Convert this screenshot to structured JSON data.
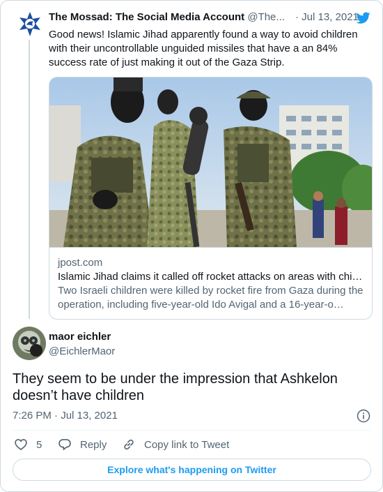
{
  "colors": {
    "brand": "#1d9bf0",
    "text_primary": "#0f1419",
    "text_secondary": "#536471",
    "border": "#cfd9de"
  },
  "parent_tweet": {
    "author_name": "The Mossad: The Social Media Account",
    "author_handle": "@The...",
    "date": "· Jul 13, 2021",
    "text": "Good news! Islamic Jihad apparently found a way to avoid children with their uncontrollable unguided missiles that have a an 84% success rate of just making it out of the Gaza Strip.",
    "link_card": {
      "image_icon": "photo-of-armed-militants",
      "domain": "jpost.com",
      "title": "Islamic Jihad claims it called off rocket attacks on areas with chi…",
      "description": "Two Israeli children were killed by rocket fire from Gaza during the operation, including five-year-old Ido Avigal and a 16-year-o…"
    }
  },
  "tweet": {
    "author_name": "maor eichler",
    "author_handle": "@EichlerMaor",
    "text": "They seem to be under the impression that Ashkelon doesn’t have children",
    "timestamp": "7:26 PM · Jul 13, 2021"
  },
  "actions": {
    "like_count": "5",
    "reply_label": "Reply",
    "copy_link_label": "Copy link to Tweet"
  },
  "explore_label": "Explore what's happening on Twitter"
}
